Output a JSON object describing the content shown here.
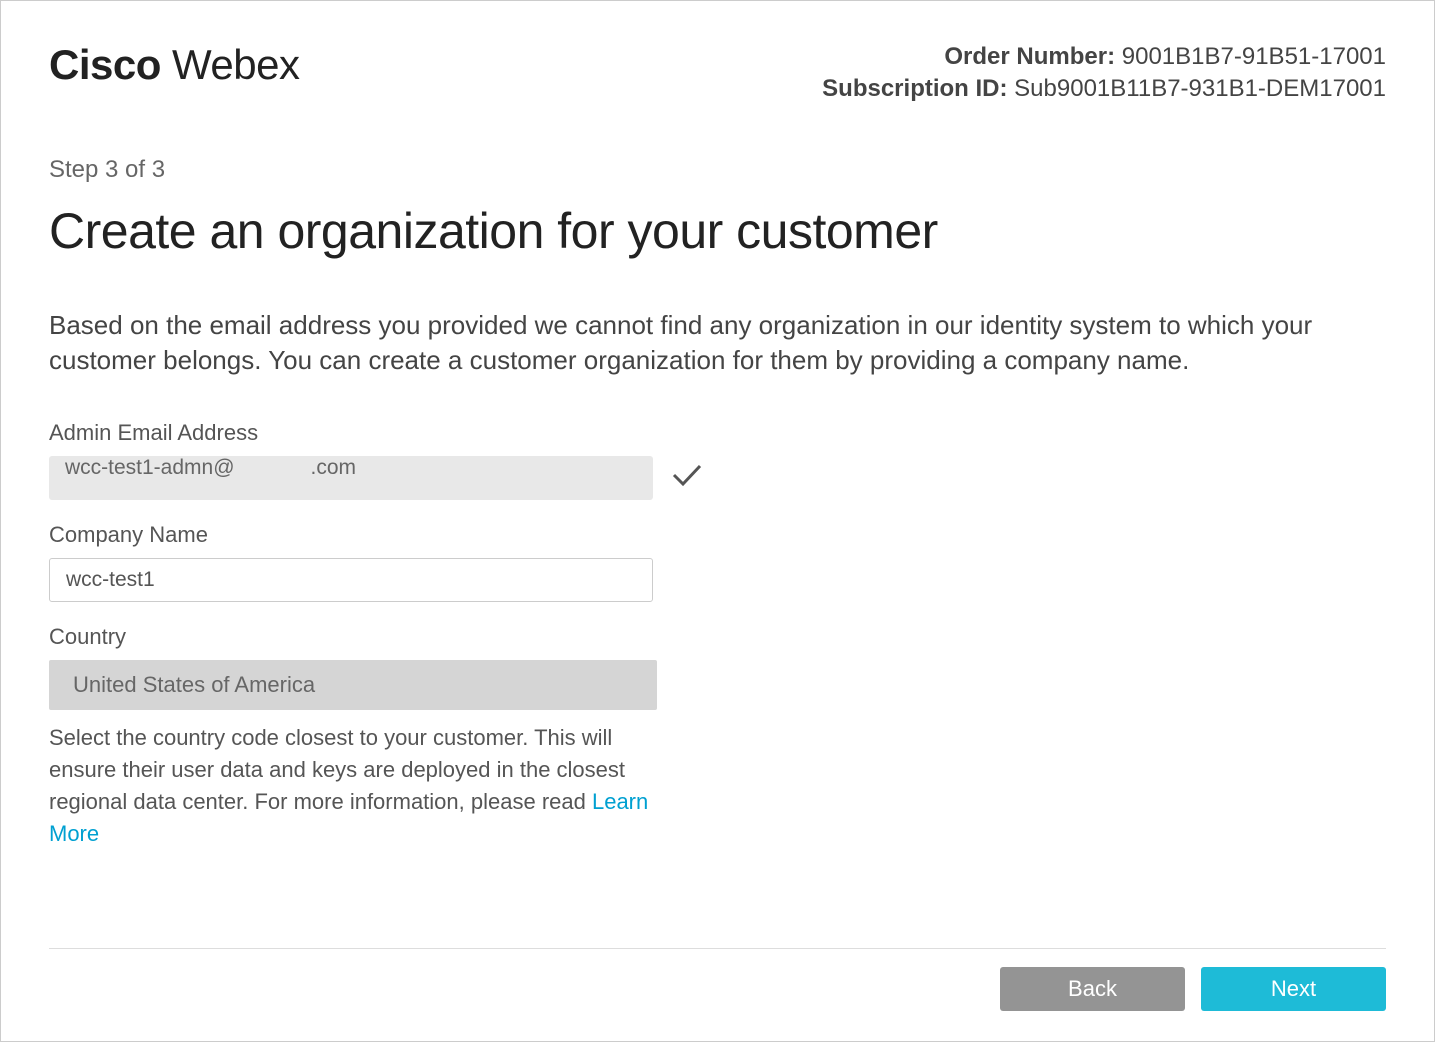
{
  "logo": {
    "bold": "Cisco",
    "light": " Webex"
  },
  "order": {
    "order_number_label": "Order Number:",
    "order_number_value": "9001B1B7-91B51-17001",
    "subscription_id_label": "Subscription ID:",
    "subscription_id_value": "Sub9001B11B7-931B1-DEM17001"
  },
  "wizard": {
    "step": "Step 3 of 3",
    "title": "Create an organization for your customer",
    "description": "Based on the email address you provided we cannot find any organization in our identity system to which your customer belongs. You can create a customer organization for them by providing a company name."
  },
  "form": {
    "email": {
      "label": "Admin Email Address",
      "prefix": "wcc-test1-admn@",
      "suffix": ".com"
    },
    "company": {
      "label": "Company Name",
      "value": "wcc-test1"
    },
    "country": {
      "label": "Country",
      "value": "United States of America",
      "help_prefix": "Select the country code closest to your customer. This will ensure their user data and keys are deployed in the closest regional data center. For more information, please read ",
      "learn_more": "Learn More"
    }
  },
  "buttons": {
    "back": "Back",
    "next": "Next"
  }
}
